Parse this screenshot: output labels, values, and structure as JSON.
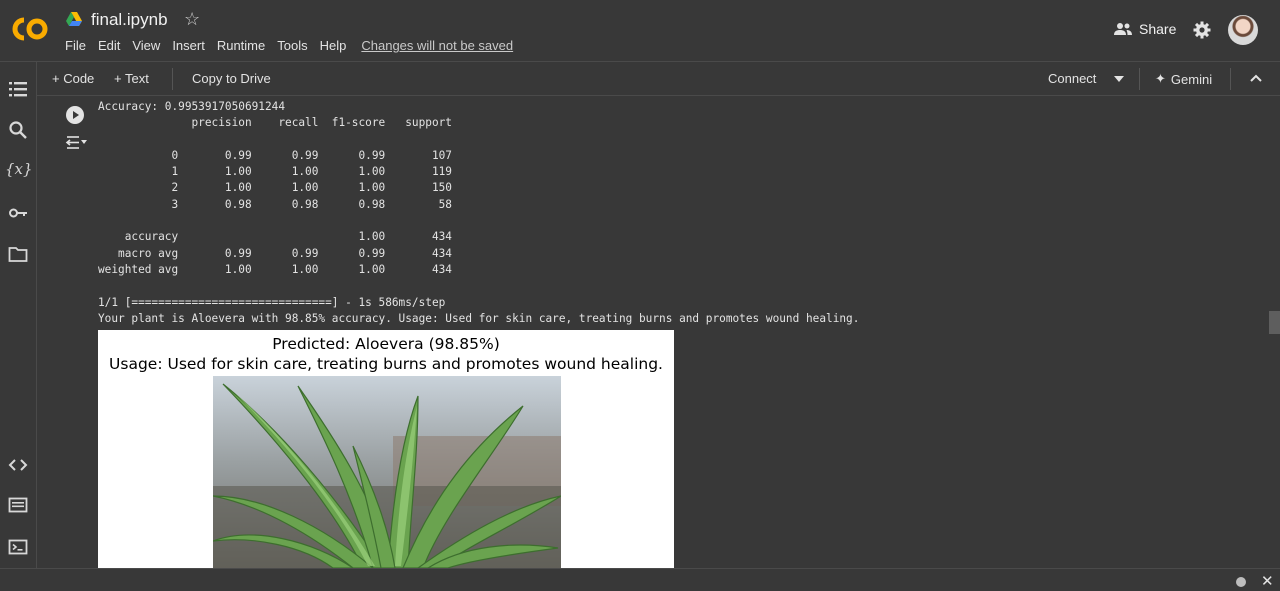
{
  "app": {
    "logo_text": "CO",
    "title": "final.ipynb",
    "brand_color": "#f9ab00"
  },
  "menu": {
    "items": [
      "File",
      "Edit",
      "View",
      "Insert",
      "Runtime",
      "Tools",
      "Help"
    ],
    "unsaved": "Changes will not be saved"
  },
  "header": {
    "share_label": "Share"
  },
  "toolbar": {
    "code_label": "+ Code",
    "text_label": "+ Text",
    "copy_label": "Copy to Drive",
    "connect_label": "Connect",
    "gemini_label": "Gemini"
  },
  "sidebar": {
    "icons": [
      "table-of-contents-icon",
      "search-icon",
      "variables-icon",
      "secrets-key-icon",
      "files-folder-icon",
      "code-snippets-icon",
      "command-palette-icon",
      "terminal-icon"
    ]
  },
  "cell": {
    "output_lines": [
      "Accuracy: 0.9953917050691244",
      "              precision    recall  f1-score   support",
      "",
      "           0       0.99      0.99      0.99       107",
      "           1       1.00      1.00      1.00       119",
      "           2       1.00      1.00      1.00       150",
      "           3       0.98      0.98      0.98        58",
      "",
      "    accuracy                           1.00       434",
      "   macro avg       0.99      0.99      0.99       434",
      "weighted avg       1.00      1.00      1.00       434",
      "",
      "1/1 [==============================] - 1s 586ms/step",
      "Your plant is Aloevera with 98.85% accuracy. Usage: Used for skin care, treating burns and promotes wound healing."
    ],
    "figure_title_1": "Predicted: Aloevera (98.85%)",
    "figure_title_2": "Usage: Used for skin care, treating burns and promotes wound healing."
  }
}
